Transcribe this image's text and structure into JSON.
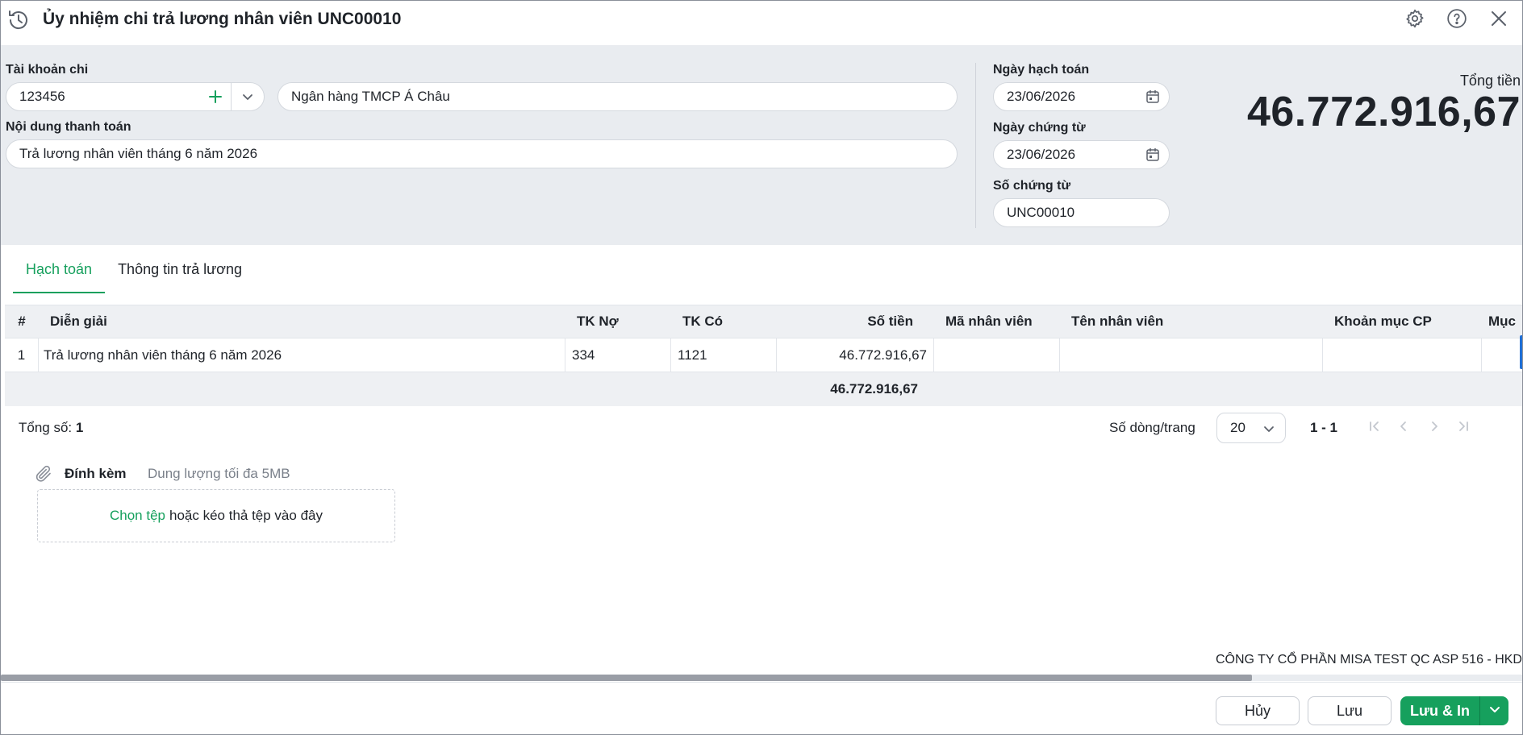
{
  "window": {
    "title": "Ủy nhiệm chi trả lương nhân viên UNC00010"
  },
  "form": {
    "account_label": "Tài khoản chi",
    "account_value": "123456",
    "bank_name": "Ngân hàng TMCP Á Châu",
    "content_label": "Nội dung thanh toán",
    "content_value": "Trả lương nhân viên tháng 6 năm 2026",
    "posting_date_label": "Ngày hạch toán",
    "posting_date": "23/06/2026",
    "voucher_date_label": "Ngày chứng từ",
    "voucher_date": "23/06/2026",
    "voucher_no_label": "Số chứng từ",
    "voucher_no": "UNC00010",
    "total_label": "Tổng tiền",
    "total_value": "46.772.916,67"
  },
  "tabs": [
    {
      "label": "Hạch toán",
      "active": true
    },
    {
      "label": "Thông tin trả lương",
      "active": false
    }
  ],
  "grid": {
    "columns": [
      "#",
      "Diễn giải",
      "TK Nợ",
      "TK Có",
      "Số tiền",
      "Mã nhân viên",
      "Tên nhân viên",
      "Khoản mục CP",
      "Mục"
    ],
    "rows": [
      [
        "1",
        "Trả lương nhân viên tháng 6 năm 2026",
        "334",
        "1121",
        "46.772.916,67",
        "",
        "",
        "",
        ""
      ]
    ],
    "sum_amount": "46.772.916,67"
  },
  "pager": {
    "total_label": "Tổng số:",
    "total_count": "1",
    "rows_per_page_label": "Số dòng/trang",
    "rows_per_page": "20",
    "range": "1 - 1"
  },
  "attachments": {
    "title": "Đính kèm",
    "hint": "Dung lượng tối đa 5MB",
    "pick_label": "Chọn tệp",
    "drop_label": "hoặc kéo thả tệp vào đây"
  },
  "company": "CÔNG TY CỔ PHẦN MISA TEST QC ASP 516 - HKD",
  "footer": {
    "cancel_label": "Hủy",
    "save_label": "Lưu",
    "save_print_label": "Lưu & In"
  },
  "colors": {
    "accent": "#16a05d",
    "form_background": "#e9ecf0",
    "grid_header_background": "#eef0f3",
    "text": "#1f2329"
  },
  "icons": {
    "history": "history-icon",
    "settings": "gear-icon",
    "help": "help-icon",
    "close": "close-icon",
    "add": "plus-icon",
    "dropdown": "chevron-down-icon",
    "calendar": "calendar-icon",
    "attach": "paperclip-icon"
  }
}
